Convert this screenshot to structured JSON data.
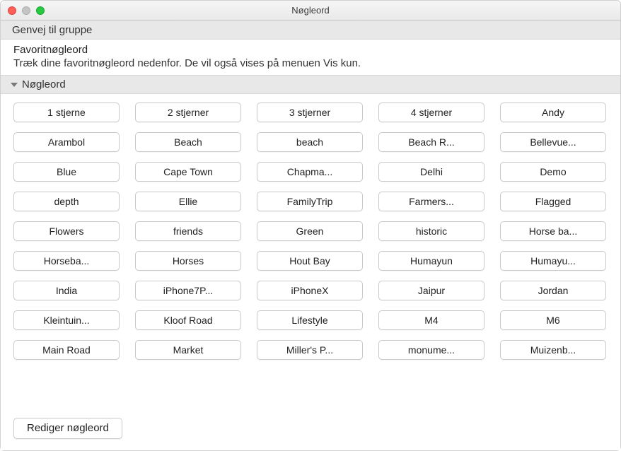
{
  "window": {
    "title": "Nøgleord"
  },
  "groupShortcut": {
    "label": "Genvej til gruppe"
  },
  "favorites": {
    "title": "Favoritnøgleord",
    "description": "Træk dine favoritnøgleord nedenfor. De vil også vises på menuen Vis kun."
  },
  "keywordsSection": {
    "label": "Nøgleord"
  },
  "keywords": [
    "1 stjerne",
    "2 stjerner",
    "3 stjerner",
    "4 stjerner",
    "Andy",
    "Arambol",
    "Beach",
    "beach",
    "Beach R...",
    "Bellevue...",
    "Blue",
    "Cape Town",
    "Chapma...",
    "Delhi",
    "Demo",
    "depth",
    "Ellie",
    "FamilyTrip",
    "Farmers...",
    "Flagged",
    "Flowers",
    "friends",
    "Green",
    "historic",
    "Horse ba...",
    "Horseba...",
    "Horses",
    "Hout Bay",
    "Humayun",
    "Humayu...",
    "India",
    "iPhone7P...",
    "iPhoneX",
    "Jaipur",
    "Jordan",
    "Kleintuin...",
    "Kloof Road",
    "Lifestyle",
    "M4",
    "M6",
    "Main Road",
    "Market",
    "Miller's P...",
    "monume...",
    "Muizenb..."
  ],
  "footer": {
    "editButton": "Rediger nøgleord"
  }
}
